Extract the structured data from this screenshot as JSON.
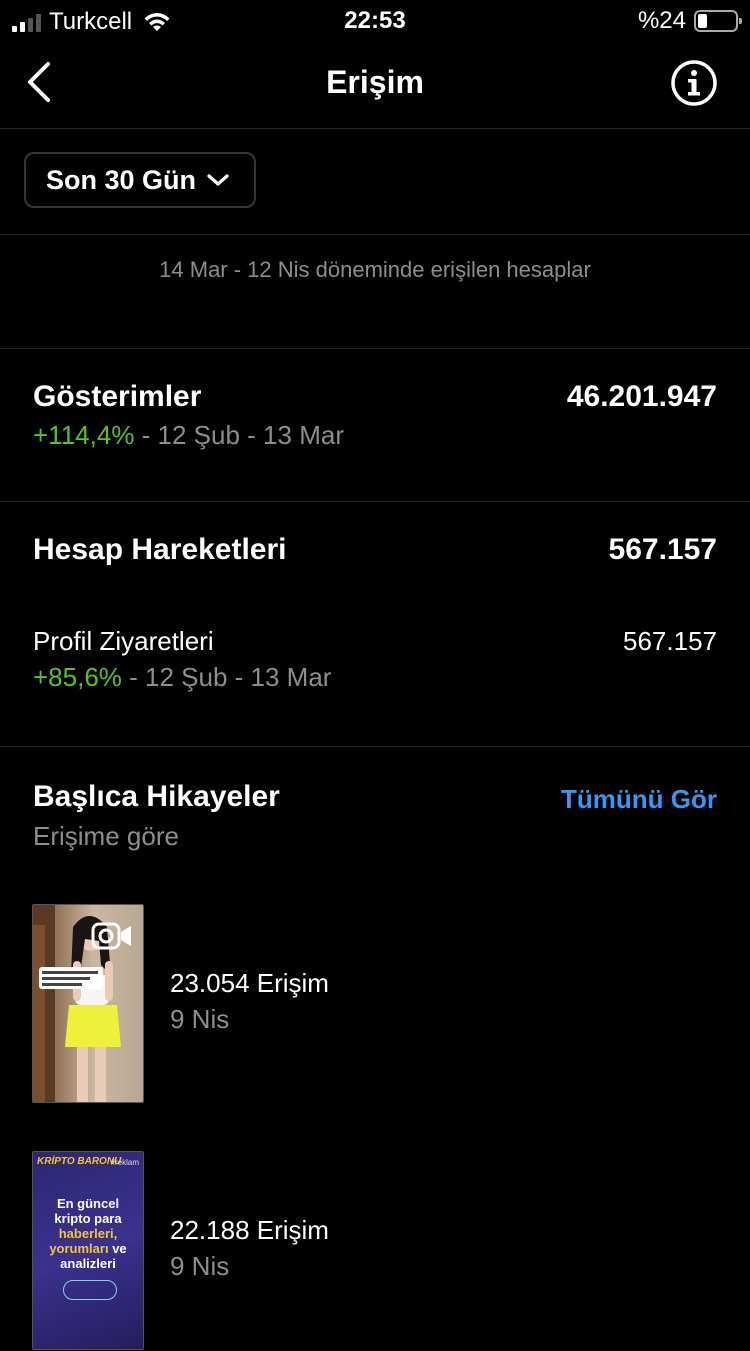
{
  "status_bar": {
    "carrier": "Turkcell",
    "time": "22:53",
    "battery": "%24"
  },
  "nav": {
    "title": "Erişim",
    "back_icon": "chevron-left-icon",
    "info_icon": "info-circle-icon"
  },
  "filter": {
    "label": "Son 30 Gün",
    "icon": "chevron-down-icon"
  },
  "period": {
    "text": "14 Mar - 12 Nis döneminde erişilen hesaplar"
  },
  "impressions": {
    "title": "Gösterimler",
    "value": "46.201.947",
    "change": "+114,4%",
    "compare": " - 12 Şub - 13 Mar"
  },
  "account_actions": {
    "title": "Hesap Hareketleri",
    "value": "567.157",
    "profile_visits": {
      "title": "Profil Ziyaretleri",
      "value": "567.157",
      "change": "+85,6%",
      "compare": " - 12 Şub - 13 Mar"
    }
  },
  "top_stories": {
    "title": "Başlıca Hikayeler",
    "subtitle": "Erişime göre",
    "see_all": "Tümünü Gör",
    "items": [
      {
        "reach": "23.054 Erişim",
        "date": "9 Nis",
        "video_icon": "video-camera-icon"
      },
      {
        "reach": "22.188 Erişim",
        "date": "9 Nis",
        "logo": "KRİPTO BARONU",
        "tag": "#reklam",
        "line1": "En güncel kripto para",
        "line2": "haberleri,",
        "line3": "yorumları",
        "line4": " ve",
        "line5": "analizleri"
      }
    ]
  },
  "colors": {
    "background": "#000000",
    "positive": "#58c322",
    "link": "#3897f0",
    "secondary_text": "#8e8e8e"
  }
}
